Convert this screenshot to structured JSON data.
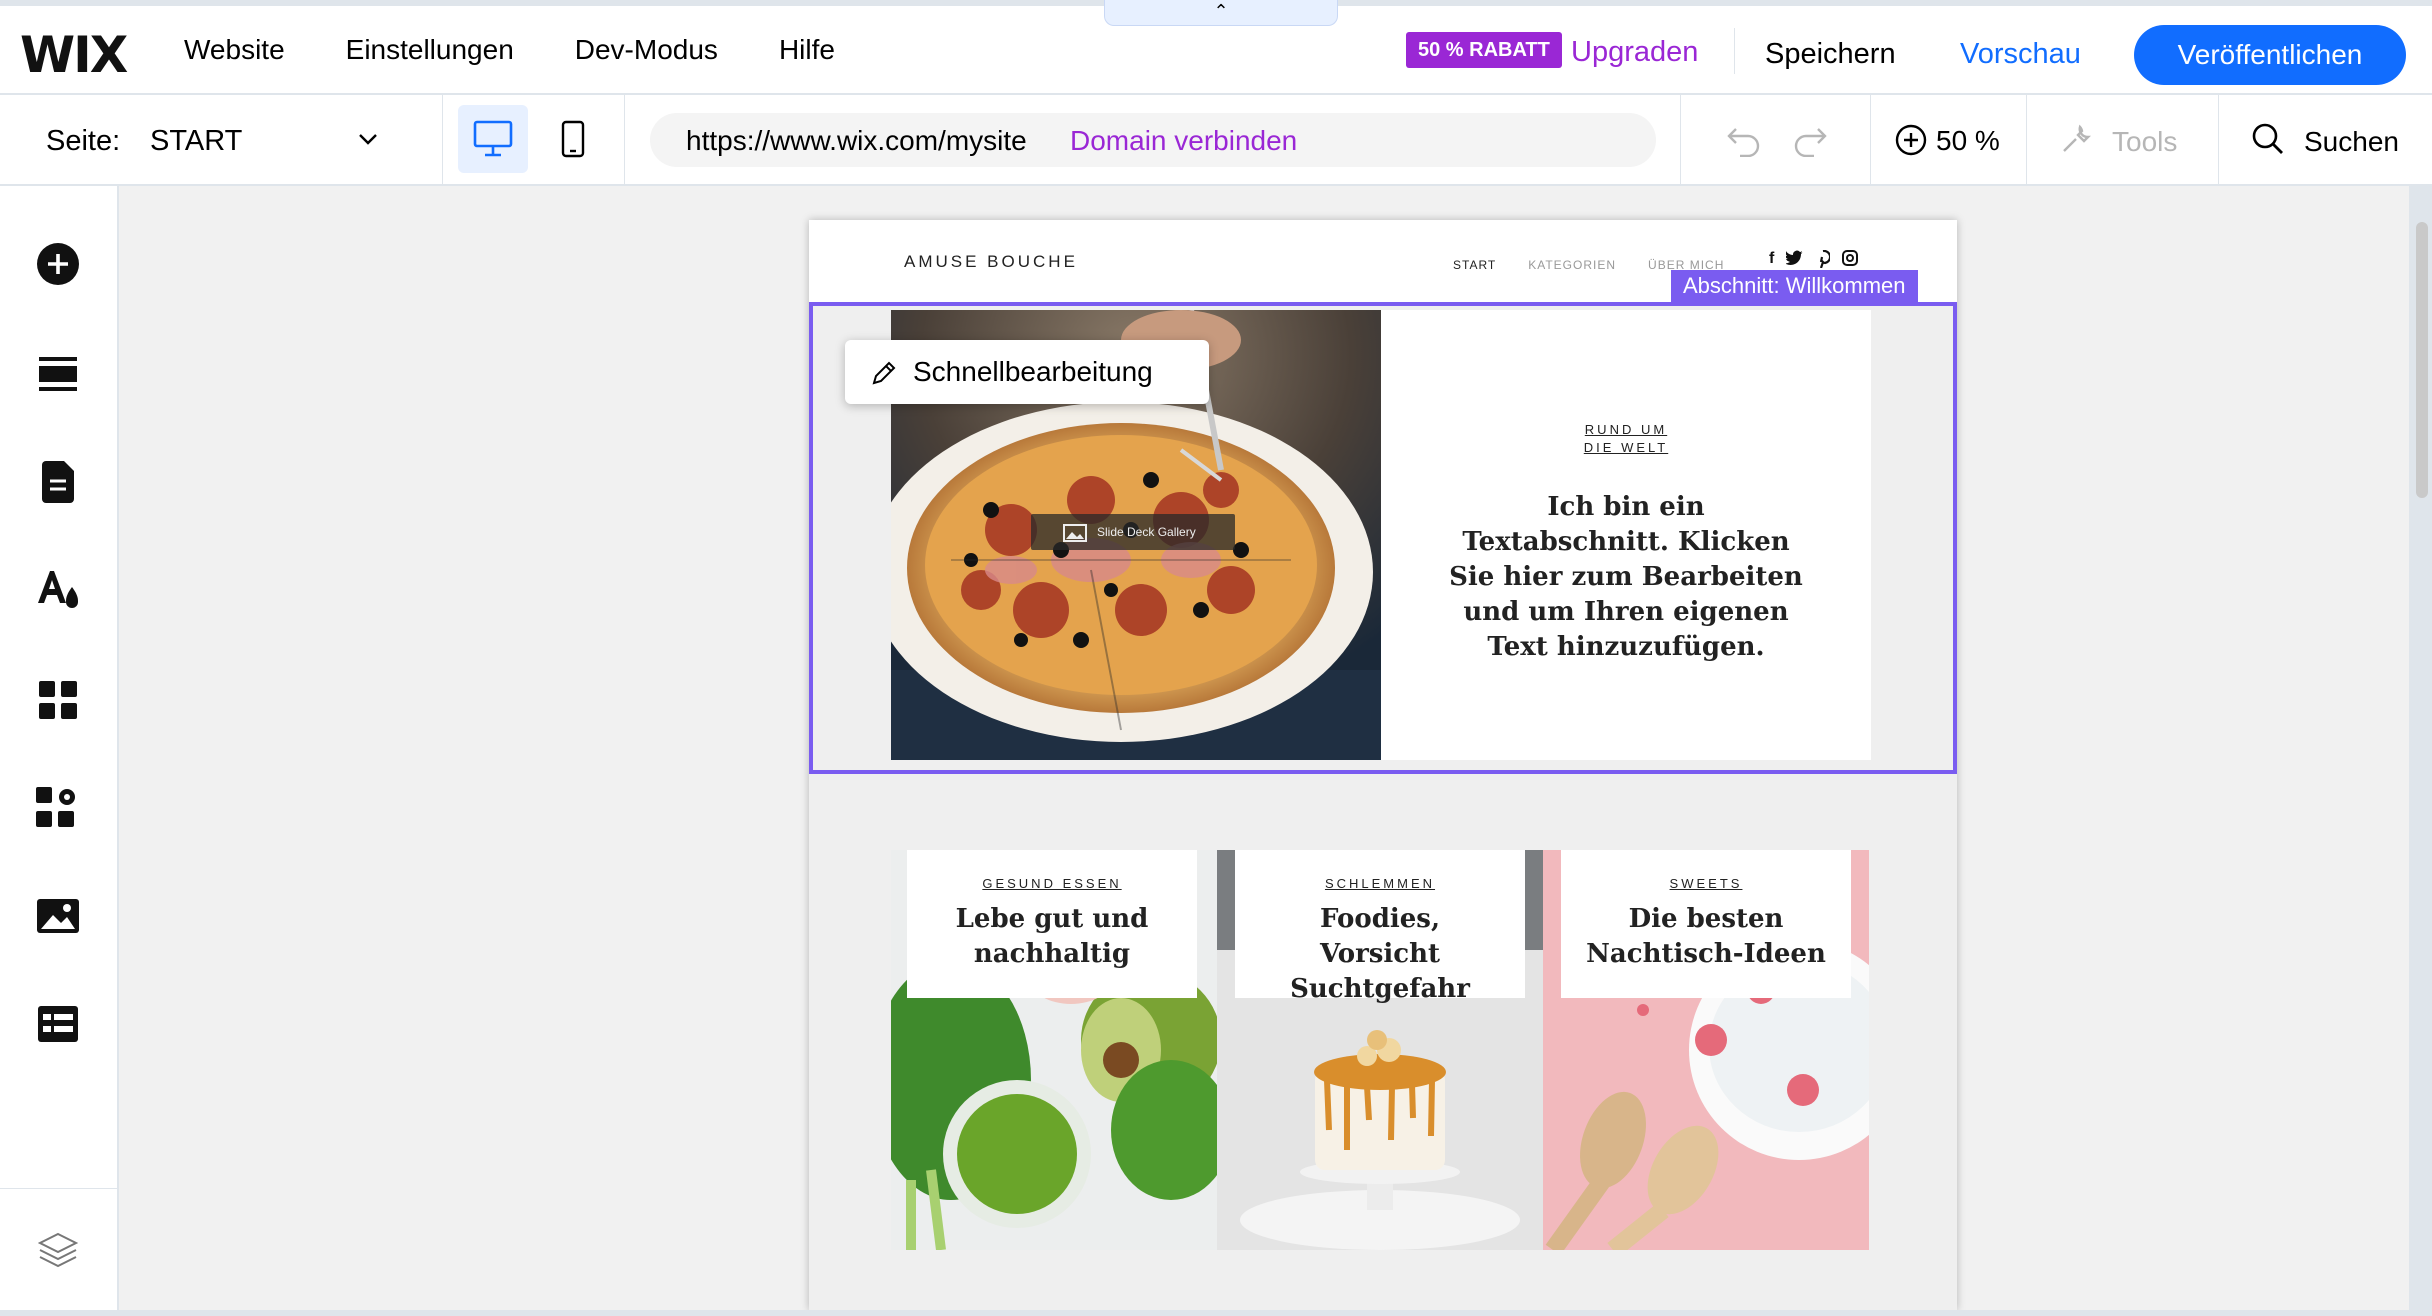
{
  "topbar": {
    "logo": "WIX",
    "nav": [
      "Website",
      "Einstellungen",
      "Dev-Modus",
      "Hilfe"
    ],
    "collapse_glyph": "⌃",
    "discount_badge": "50 % RABATT",
    "upgrade": "Upgraden",
    "save": "Speichern",
    "preview": "Vorschau",
    "publish": "Veröffentlichen"
  },
  "toolbar": {
    "page_label": "Seite:",
    "page_value": "START",
    "url": "https://www.wix.com/mysite",
    "domain_link": "Domain verbinden",
    "zoom": "50 %",
    "tools": "Tools",
    "search": "Suchen"
  },
  "sidebar": {
    "items": [
      "add-icon",
      "sections-icon",
      "pages-icon",
      "design-icon",
      "apps-icon",
      "business-icon",
      "media-icon",
      "cms-icon",
      "layers-icon"
    ]
  },
  "site": {
    "brand": "AMUSE BOUCHE",
    "nav": [
      "START",
      "KATEGORIEN",
      "ÜBER MICH"
    ],
    "social_icons": [
      "facebook-icon",
      "twitter-icon",
      "pinterest-icon",
      "instagram-icon"
    ],
    "section_tag": "Abschnitt: Willkommen",
    "quick_edit": "Schnellbearbeitung",
    "gallery_badge": "Slide Deck Gallery",
    "hero": {
      "category_line1": "RUND UM",
      "category_line2": "DIE WELT",
      "text": "Ich bin ein Textabschnitt. Klicken Sie hier zum Bearbeiten und um Ihren eigenen Text hinzuzufügen."
    },
    "cards": [
      {
        "category": "GESUND ESSEN",
        "title_line1": "Lebe gut und",
        "title_line2": "nachhaltig"
      },
      {
        "category": "SCHLEMMEN",
        "title_line1": "Foodies,",
        "title_line2": "Vorsicht Suchtgefahr"
      },
      {
        "category": "SWEETS",
        "title_line1": "Die besten",
        "title_line2": "Nachtisch-Ideen"
      }
    ]
  },
  "colors": {
    "accent_blue": "#116dff",
    "accent_purple": "#9a27d5",
    "section_frame": "#7a5cf0"
  }
}
